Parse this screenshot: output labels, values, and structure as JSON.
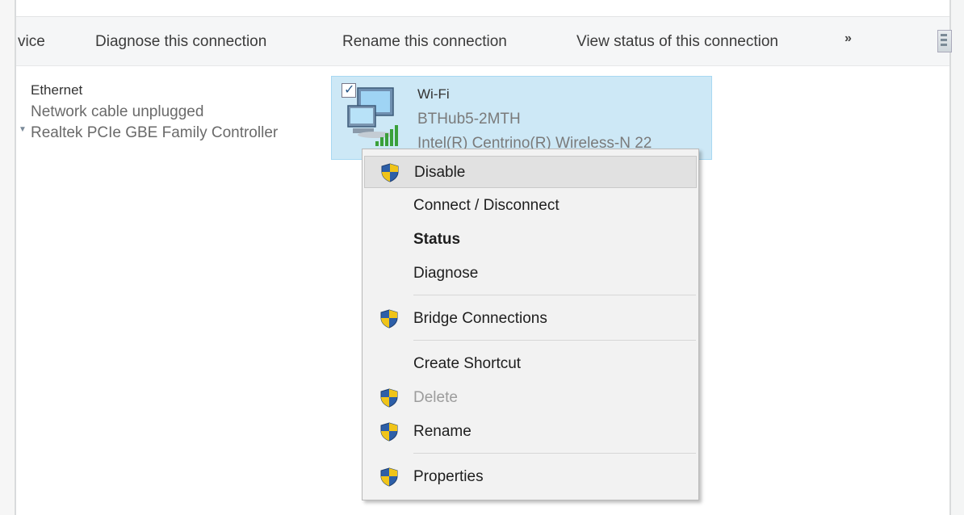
{
  "toolbar": {
    "items": [
      {
        "label": "vice"
      },
      {
        "label": "Diagnose this connection"
      },
      {
        "label": "Rename this connection"
      },
      {
        "label": "View status of this connection"
      }
    ],
    "more_label": "»"
  },
  "connections": {
    "ethernet": {
      "name": "Ethernet",
      "status": "Network cable unplugged",
      "adapter": "Realtek PCIe GBE Family Controller"
    },
    "wifi": {
      "name": "Wi-Fi",
      "ssid": "BTHub5-2MTH",
      "adapter": "Intel(R) Centrino(R) Wireless-N 22"
    }
  },
  "context_menu": {
    "items": [
      {
        "label": "Disable",
        "shield": true,
        "state": "hover"
      },
      {
        "label": "Connect / Disconnect",
        "shield": false
      },
      {
        "label": "Status",
        "shield": false,
        "bold": true
      },
      {
        "label": "Diagnose",
        "shield": false
      },
      {
        "label": "Bridge Connections",
        "shield": true
      },
      {
        "label": "Create Shortcut",
        "shield": false
      },
      {
        "label": "Delete",
        "shield": true,
        "disabled": true
      },
      {
        "label": "Rename",
        "shield": true
      },
      {
        "label": "Properties",
        "shield": true
      }
    ]
  },
  "icons": {
    "shield": "uac-shield-icon",
    "wifi_adapter": "network-computer-icon",
    "signal": "wifi-signal-icon",
    "checkbox": "checkbox-icon",
    "view": "view-options-icon"
  },
  "colors": {
    "selection_bg": "#cde8f6",
    "selection_border": "#a8d8f2",
    "menu_bg": "#f2f2f2",
    "menu_hover": "#e1e1e1",
    "toolbar_bg": "#f5f6f7"
  }
}
